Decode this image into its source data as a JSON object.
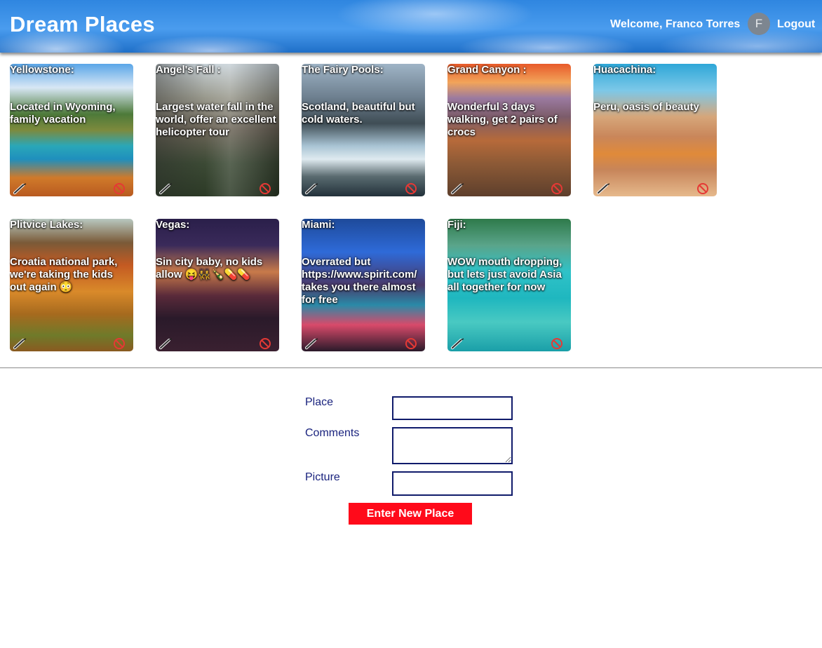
{
  "header": {
    "title": "Dream Places",
    "welcome": "Welcome, Franco Torres",
    "avatar_initial": "F",
    "logout": "Logout"
  },
  "places": [
    {
      "title": "Yellowstone:",
      "comment": "Located in Wyoming, family vacation",
      "image": "yellowstone-hot-spring"
    },
    {
      "title": "Angel's Fall :",
      "comment": "Largest water fall in the world, offer an excellent helicopter tour",
      "image": "angel-falls"
    },
    {
      "title": "The Fairy Pools:",
      "comment": "Scotland, beautiful but cold waters.",
      "image": "fairy-pools-waterfall"
    },
    {
      "title": "Grand Canyon :",
      "comment": "Wonderful 3 days walking, get 2 pairs of crocs",
      "image": "grand-canyon-sunset"
    },
    {
      "title": "Huacachina:",
      "comment": "Peru, oasis of beauty",
      "image": "huacachina-desert-oasis"
    },
    {
      "title": "Plitvice Lakes:",
      "comment": "Croatia national park, we're taking the kids out again 😳",
      "image": "plitvice-autumn"
    },
    {
      "title": "Vegas:",
      "comment": "Sin city baby, no kids allow 😝👯‍♀️🍾💊💊",
      "image": "las-vegas-night"
    },
    {
      "title": "Miami:",
      "comment": "Overrated but https://www.spirit.com/ takes you there almost for free",
      "image": "miami-ocean-drive"
    },
    {
      "title": "Fiji:",
      "comment": "WOW mouth dropping, but lets just avoid Asia all together for now",
      "image": "fiji-island-reef"
    }
  ],
  "card_actions": {
    "edit_icon": "pen-icon",
    "delete_icon": "prohibited-icon"
  },
  "form": {
    "place_label": "Place",
    "place_value": "",
    "comments_label": "Comments",
    "comments_value": "",
    "picture_label": "Picture",
    "picture_value": "",
    "submit_label": "Enter New Place"
  },
  "colors": {
    "header_blue": "#2f86e0",
    "label_navy": "#1a237e",
    "submit_red": "#ff0a1a",
    "delete_red": "#e53935"
  }
}
